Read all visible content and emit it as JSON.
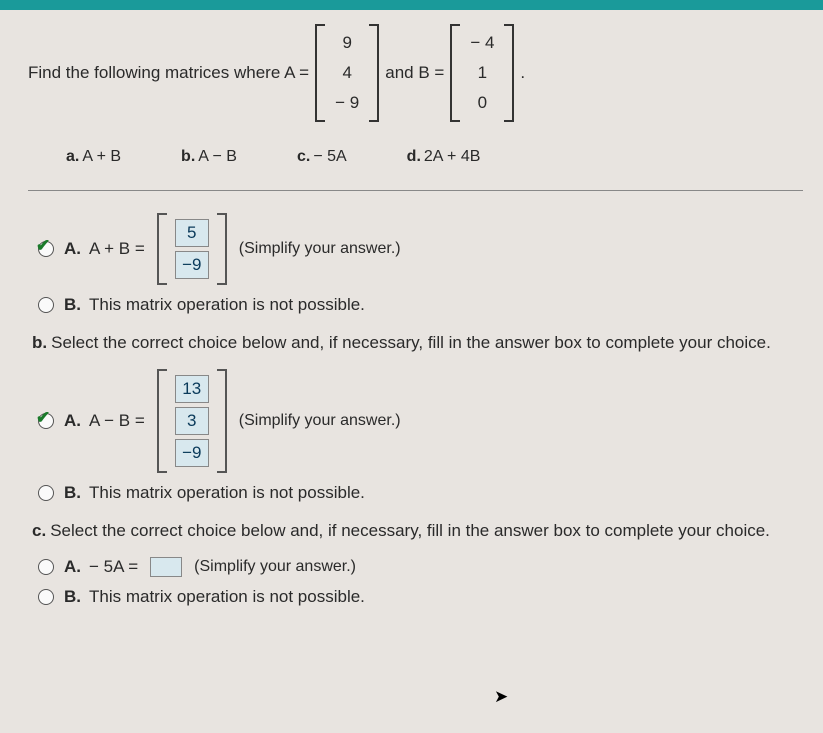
{
  "header": {
    "prompt": "Find the following matrices where A =",
    "and": " and B =",
    "period": ".",
    "A": [
      "9",
      "4",
      "− 9"
    ],
    "B": [
      "− 4",
      "1",
      "0"
    ]
  },
  "parts": [
    {
      "label": "a.",
      "text": "A + B"
    },
    {
      "label": "b.",
      "text": "A − B"
    },
    {
      "label": "c.",
      "text": "− 5A"
    },
    {
      "label": "d.",
      "text": "2A + 4B"
    }
  ],
  "qA": {
    "optA_label": "A.",
    "optA_eq": "A + B =",
    "optA_vals": [
      "5",
      "−9"
    ],
    "hint": "(Simplify your answer.)",
    "optB_label": "B.",
    "optB_text": "This matrix operation is not possible."
  },
  "qB": {
    "prompt_pre": "b.",
    "prompt": "Select the correct choice below and, if necessary, fill in the answer box to complete your choice.",
    "optA_label": "A.",
    "optA_eq": "A − B =",
    "optA_vals": [
      "13",
      "3",
      "−9"
    ],
    "hint": "(Simplify your answer.)",
    "optB_label": "B.",
    "optB_text": "This matrix operation is not possible."
  },
  "qC": {
    "prompt_pre": "c.",
    "prompt": "Select the correct choice below and, if necessary, fill in the answer box to complete your choice.",
    "optA_label": "A.",
    "optA_eq": "− 5A =",
    "hint": "(Simplify your answer.)",
    "optB_label": "B.",
    "optB_text": "This matrix operation is not possible."
  }
}
